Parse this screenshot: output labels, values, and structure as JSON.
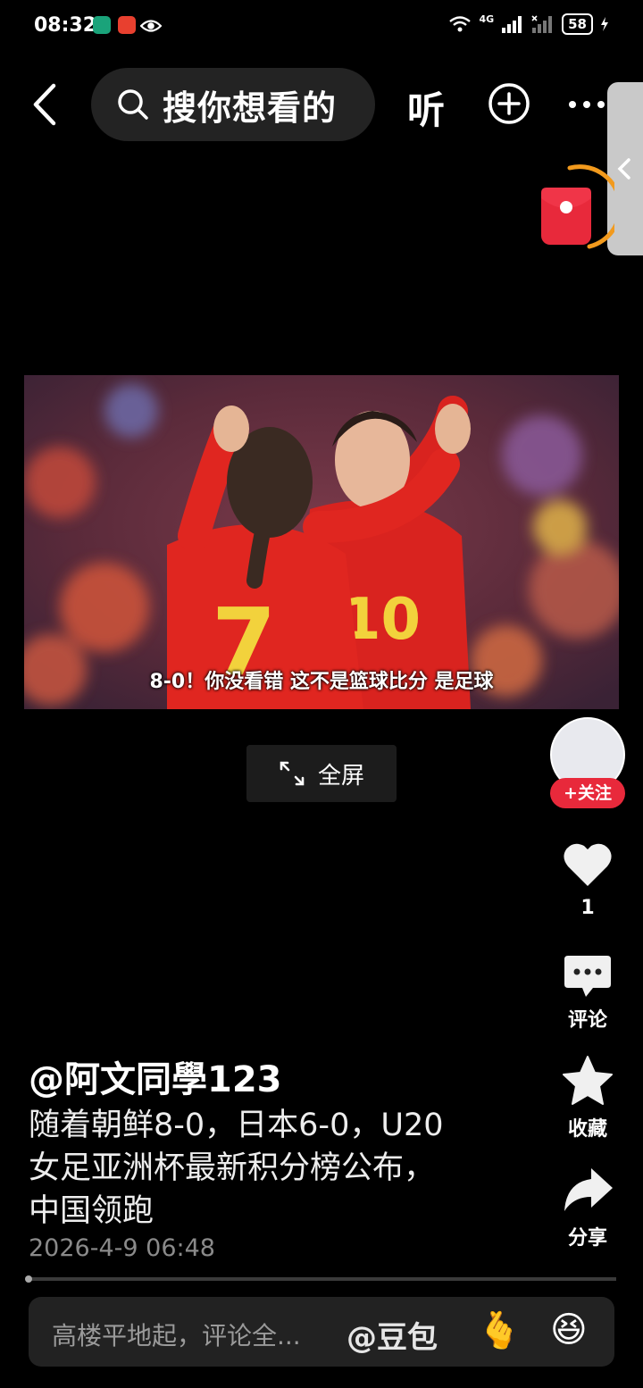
{
  "status_bar": {
    "time": "08:32",
    "battery": "58",
    "network": "4G"
  },
  "top_bar": {
    "search_placeholder": "搜你想看的",
    "listen_label": "听"
  },
  "video": {
    "subtitle": "8-0！你没看错 这不是篮球比分 是足球",
    "jersey_numbers": [
      "7",
      "10"
    ]
  },
  "fullscreen_label": "全屏",
  "rail": {
    "follow_label": "+关注",
    "like_count": "1",
    "comment_label": "评论",
    "favorite_label": "收藏",
    "share_label": "分享"
  },
  "post": {
    "author": "@阿文同學123",
    "description_lines": [
      "随着朝鲜8-0，日本6-0，U20",
      "女足亚洲杯最新积分榜公布，",
      "中国领跑"
    ],
    "date": "2026-4-9 06:48"
  },
  "comment_bar": {
    "placeholder": "高楼平地起，评论全...",
    "mention": "@豆包",
    "emoji_1": "🫰",
    "emoji_2": "😆"
  },
  "colors": {
    "accent_red": "#e8293b",
    "ring_orange": "#f29a1d"
  }
}
